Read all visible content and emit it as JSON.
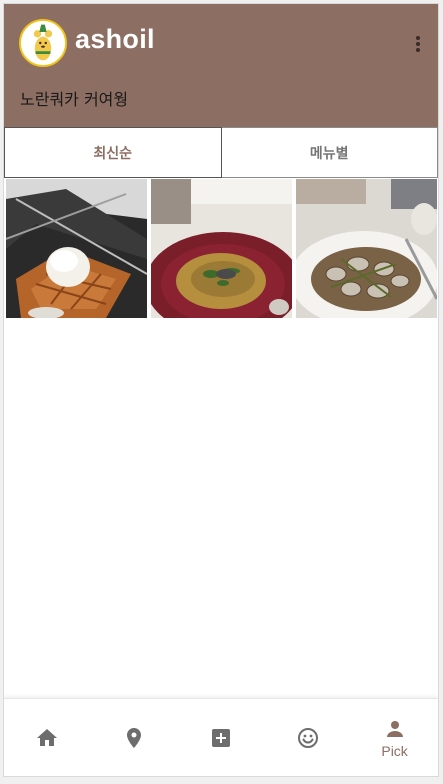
{
  "profile": {
    "username": "ashoil",
    "bio": "노란쿼카 커여웡"
  },
  "tabs": [
    {
      "label": "최신순",
      "active": true
    },
    {
      "label": "메뉴별",
      "active": false
    }
  ],
  "posts": [
    {
      "icon": "waffle-photo"
    },
    {
      "icon": "risotto-photo"
    },
    {
      "icon": "clam-pasta-photo"
    }
  ],
  "bottom_nav": {
    "home": {
      "icon": "home-icon"
    },
    "map": {
      "icon": "location-pin-icon"
    },
    "add": {
      "icon": "add-box-icon"
    },
    "feed": {
      "icon": "smiley-icon"
    },
    "pick": {
      "icon": "person-icon",
      "label": "Pick",
      "active": true
    }
  },
  "colors": {
    "accent": "#8d6e63",
    "icon_inactive": "#6d6d6d"
  }
}
